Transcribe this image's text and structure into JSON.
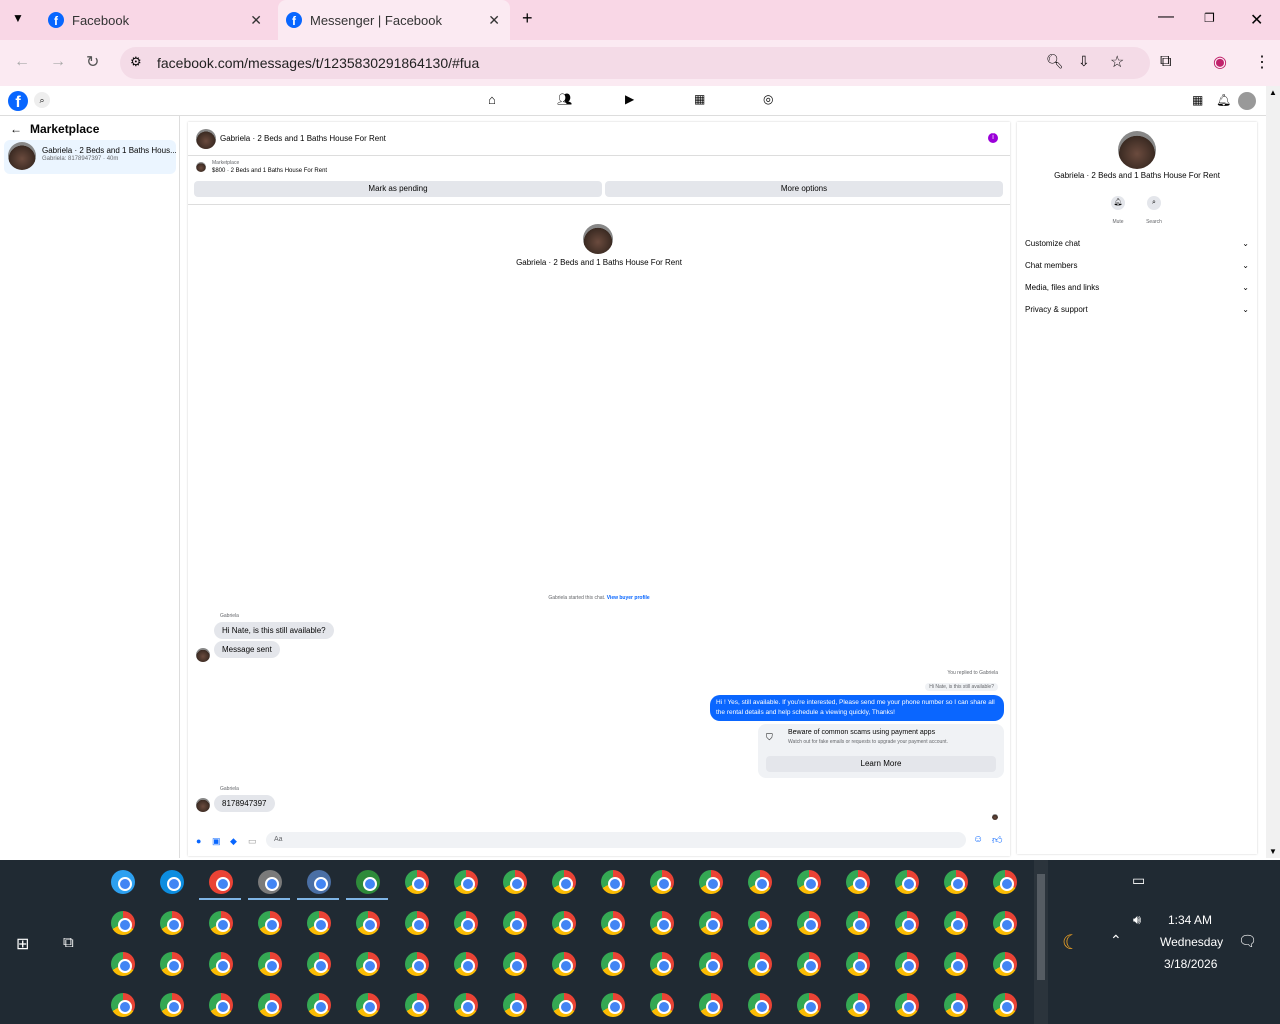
{
  "browser": {
    "tabs": [
      {
        "title": "Facebook"
      },
      {
        "title": "Messenger | Facebook"
      }
    ],
    "url": "facebook.com/messages/t/1235830291864130/#fua"
  },
  "left": {
    "section_title": "Marketplace",
    "conversation": {
      "title": "Gabriela · 2 Beds and 1 Baths Hous...",
      "preview": "Gabriela: 8178947397 · 40m"
    }
  },
  "chat": {
    "header_title": "Gabriela · 2 Beds and 1 Baths House For Rent",
    "listing_label": "Marketplace",
    "listing_detail": "$800 · 2 Beds and 1 Baths House For Rent",
    "mark_pending": "Mark as pending",
    "more_options": "More options",
    "center_title": "Gabriela · 2 Beds and 1 Baths House For Rent",
    "started_text": "Gabriela started this chat.",
    "view_profile": "View buyer profile",
    "msg1_sender": "Gabriela",
    "msg1": "Hi Nate, is this still available?",
    "msg2": "Message sent",
    "reply_label": "You replied to Gabriela",
    "reply_quote": "Hi Nate, is this still available?",
    "my_msg": "Hi ! Yes, still available. If you're interested, Please send me your phone number so I can share all the rental details and help schedule a viewing quickly, Thanks!",
    "scam_title": "Beware of common scams using payment apps",
    "scam_text": "Watch out for fake emails or requests to upgrade your payment account.",
    "learn_more": "Learn More",
    "msg3_sender": "Gabriela",
    "msg3": "8178947397",
    "composer_placeholder": "Aa"
  },
  "right": {
    "title": "Gabriela · 2 Beds and 1 Baths House For Rent",
    "mute": "Mute",
    "search": "Search",
    "rows": [
      "Customize chat",
      "Chat members",
      "Media, files and links",
      "Privacy & support"
    ]
  },
  "taskbar": {
    "time": "1:34 AM",
    "day": "Wednesday",
    "date": "3/18/2026"
  },
  "colors": {
    "accent": "#0866ff",
    "my_bubble": "#0a66ff",
    "tabbar": "#f9d7e6"
  }
}
